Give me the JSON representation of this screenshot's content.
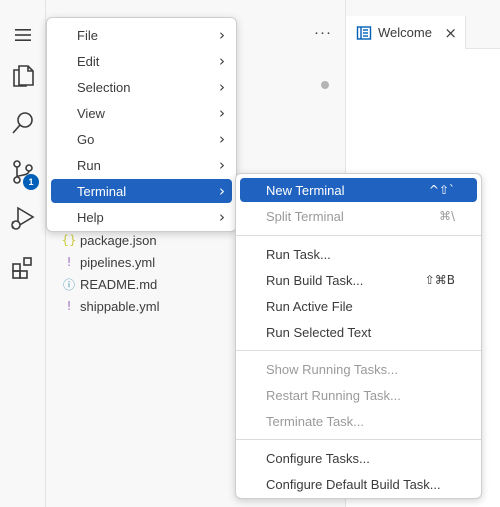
{
  "explorer": {
    "more_actions": "···",
    "files": [
      {
        "name": "package.json",
        "icon": "{}",
        "color": "#cbcb41"
      },
      {
        "name": "pipelines.yml",
        "icon": "!",
        "color": "#a074c4"
      },
      {
        "name": "README.md",
        "icon": "ⓘ",
        "color": "#519aba"
      },
      {
        "name": "shippable.yml",
        "icon": "!",
        "color": "#a074c4"
      }
    ]
  },
  "activity_bar": {
    "scm_badge": "1"
  },
  "editor": {
    "tab_label": "Welcome",
    "tab_close": "×"
  },
  "menu": {
    "items": [
      "File",
      "Edit",
      "Selection",
      "View",
      "Go",
      "Run",
      "Terminal",
      "Help"
    ],
    "chevron": "›",
    "active_item": "Terminal"
  },
  "terminal_menu": {
    "items": [
      {
        "label": "New Terminal",
        "shortcut": "^⇧`",
        "state": "active"
      },
      {
        "label": "Split Terminal",
        "shortcut": "⌘\\",
        "state": "disabled"
      },
      {
        "label": "Run Task...",
        "shortcut": "",
        "state": "normal"
      },
      {
        "label": "Run Build Task...",
        "shortcut": "⇧⌘B",
        "state": "normal"
      },
      {
        "label": "Run Active File",
        "shortcut": "",
        "state": "normal"
      },
      {
        "label": "Run Selected Text",
        "shortcut": "",
        "state": "normal"
      },
      {
        "label": "Show Running Tasks...",
        "shortcut": "",
        "state": "disabled"
      },
      {
        "label": "Restart Running Task...",
        "shortcut": "",
        "state": "disabled"
      },
      {
        "label": "Terminate Task...",
        "shortcut": "",
        "state": "disabled"
      },
      {
        "label": "Configure Tasks...",
        "shortcut": "",
        "state": "normal"
      },
      {
        "label": "Configure Default Build Task...",
        "shortcut": "",
        "state": "normal"
      }
    ]
  },
  "colors": {
    "accent": "#1f62bf",
    "badge": "#005fb8",
    "disabled_text": "#9a9a9a"
  }
}
